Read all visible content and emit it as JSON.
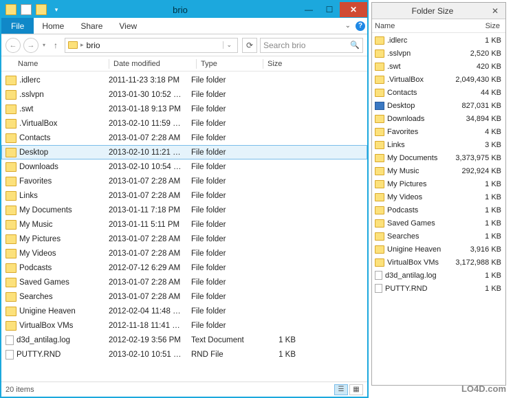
{
  "window": {
    "title": "brio",
    "minimize": "—",
    "maximize": "☐",
    "close": "✕"
  },
  "ribbon": {
    "file": "File",
    "home": "Home",
    "share": "Share",
    "view": "View"
  },
  "nav": {
    "crumb": "brio",
    "search_placeholder": "Search brio"
  },
  "headers": {
    "name": "Name",
    "date": "Date modified",
    "type": "Type",
    "size": "Size"
  },
  "files": [
    {
      "name": ".idlerc",
      "date": "2011-11-23 3:18 PM",
      "type": "File folder",
      "size": "",
      "icon": "folder",
      "selected": false
    },
    {
      "name": ".sslvpn",
      "date": "2013-01-30 10:52 …",
      "type": "File folder",
      "size": "",
      "icon": "folder",
      "selected": false
    },
    {
      "name": ".swt",
      "date": "2013-01-18 9:13 PM",
      "type": "File folder",
      "size": "",
      "icon": "folder",
      "selected": false
    },
    {
      "name": ".VirtualBox",
      "date": "2013-02-10 11:59 …",
      "type": "File folder",
      "size": "",
      "icon": "folder",
      "selected": false
    },
    {
      "name": "Contacts",
      "date": "2013-01-07 2:28 AM",
      "type": "File folder",
      "size": "",
      "icon": "folder",
      "selected": false
    },
    {
      "name": "Desktop",
      "date": "2013-02-10 11:21 …",
      "type": "File folder",
      "size": "",
      "icon": "folder",
      "selected": true
    },
    {
      "name": "Downloads",
      "date": "2013-02-10 10:54 …",
      "type": "File folder",
      "size": "",
      "icon": "folder",
      "selected": false
    },
    {
      "name": "Favorites",
      "date": "2013-01-07 2:28 AM",
      "type": "File folder",
      "size": "",
      "icon": "folder",
      "selected": false
    },
    {
      "name": "Links",
      "date": "2013-01-07 2:28 AM",
      "type": "File folder",
      "size": "",
      "icon": "folder",
      "selected": false
    },
    {
      "name": "My Documents",
      "date": "2013-01-11 7:18 PM",
      "type": "File folder",
      "size": "",
      "icon": "folder",
      "selected": false
    },
    {
      "name": "My Music",
      "date": "2013-01-11 5:11 PM",
      "type": "File folder",
      "size": "",
      "icon": "folder",
      "selected": false
    },
    {
      "name": "My Pictures",
      "date": "2013-01-07 2:28 AM",
      "type": "File folder",
      "size": "",
      "icon": "folder",
      "selected": false
    },
    {
      "name": "My Videos",
      "date": "2013-01-07 2:28 AM",
      "type": "File folder",
      "size": "",
      "icon": "folder",
      "selected": false
    },
    {
      "name": "Podcasts",
      "date": "2012-07-12 6:29 AM",
      "type": "File folder",
      "size": "",
      "icon": "folder",
      "selected": false
    },
    {
      "name": "Saved Games",
      "date": "2013-01-07 2:28 AM",
      "type": "File folder",
      "size": "",
      "icon": "folder",
      "selected": false
    },
    {
      "name": "Searches",
      "date": "2013-01-07 2:28 AM",
      "type": "File folder",
      "size": "",
      "icon": "folder",
      "selected": false
    },
    {
      "name": "Unigine Heaven",
      "date": "2012-02-04 11:48 …",
      "type": "File folder",
      "size": "",
      "icon": "folder",
      "selected": false
    },
    {
      "name": "VirtualBox VMs",
      "date": "2012-11-18 11:41 …",
      "type": "File folder",
      "size": "",
      "icon": "folder",
      "selected": false
    },
    {
      "name": "d3d_antilag.log",
      "date": "2012-02-19 3:56 PM",
      "type": "Text Document",
      "size": "1 KB",
      "icon": "txt",
      "selected": false
    },
    {
      "name": "PUTTY.RND",
      "date": "2013-02-10 10:51 …",
      "type": "RND File",
      "size": "1 KB",
      "icon": "rnd",
      "selected": false
    }
  ],
  "status": {
    "count": "20 items"
  },
  "fs": {
    "title": "Folder Size",
    "headers": {
      "name": "Name",
      "size": "Size"
    },
    "rows": [
      {
        "name": ".idlerc",
        "size": "1 KB",
        "icon": "folder"
      },
      {
        "name": ".sslvpn",
        "size": "2,520 KB",
        "icon": "folder"
      },
      {
        "name": ".swt",
        "size": "420 KB",
        "icon": "folder"
      },
      {
        "name": ".VirtualBox",
        "size": "2,049,430 KB",
        "icon": "folder"
      },
      {
        "name": "Contacts",
        "size": "44 KB",
        "icon": "folder"
      },
      {
        "name": "Desktop",
        "size": "827,031 KB",
        "icon": "desktop"
      },
      {
        "name": "Downloads",
        "size": "34,894 KB",
        "icon": "folder"
      },
      {
        "name": "Favorites",
        "size": "4 KB",
        "icon": "folder"
      },
      {
        "name": "Links",
        "size": "3 KB",
        "icon": "folder"
      },
      {
        "name": "My Documents",
        "size": "3,373,975 KB",
        "icon": "folder"
      },
      {
        "name": "My Music",
        "size": "292,924 KB",
        "icon": "folder"
      },
      {
        "name": "My Pictures",
        "size": "1 KB",
        "icon": "folder"
      },
      {
        "name": "My Videos",
        "size": "1 KB",
        "icon": "folder"
      },
      {
        "name": "Podcasts",
        "size": "1 KB",
        "icon": "folder"
      },
      {
        "name": "Saved Games",
        "size": "1 KB",
        "icon": "folder"
      },
      {
        "name": "Searches",
        "size": "1 KB",
        "icon": "folder"
      },
      {
        "name": "Unigine Heaven",
        "size": "3,916 KB",
        "icon": "folder"
      },
      {
        "name": "VirtualBox VMs",
        "size": "3,172,988 KB",
        "icon": "folder"
      },
      {
        "name": "d3d_antilag.log",
        "size": "1 KB",
        "icon": "doc"
      },
      {
        "name": "PUTTY.RND",
        "size": "1 KB",
        "icon": "doc"
      }
    ]
  },
  "watermark": "LO4D.com"
}
